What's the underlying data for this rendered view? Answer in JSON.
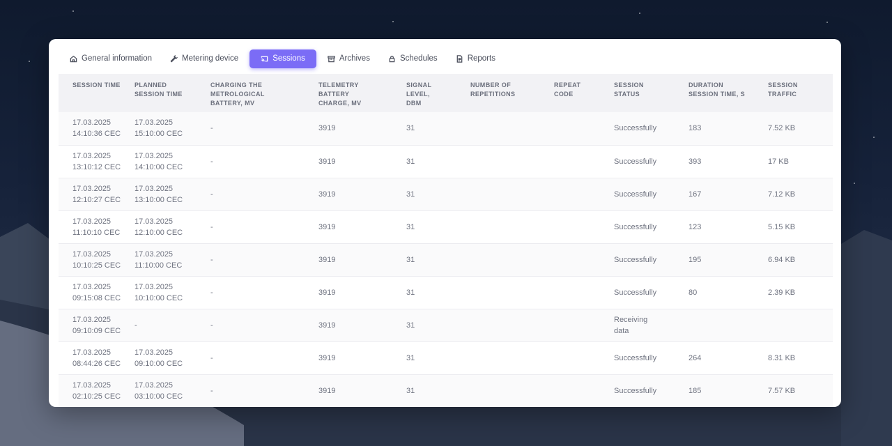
{
  "tabs": [
    {
      "label": "General information",
      "icon": "home-icon",
      "active": false
    },
    {
      "label": "Metering device",
      "icon": "wrench-icon",
      "active": false
    },
    {
      "label": "Sessions",
      "icon": "cast-icon",
      "active": true
    },
    {
      "label": "Archives",
      "icon": "archive-icon",
      "active": false
    },
    {
      "label": "Schedules",
      "icon": "lock-icon",
      "active": false
    },
    {
      "label": "Reports",
      "icon": "document-icon",
      "active": false
    }
  ],
  "accent_color": "#7b6cf6",
  "table": {
    "columns": [
      "SESSION TIME",
      "PLANNED SESSION TIME",
      "CHARGING THE METROLOGICAL BATTERY, MV",
      "TELEMETRY BATTERY CHARGE, MV",
      "SIGNAL LEVEL, DBM",
      "NUMBER OF REPETITIONS",
      "REPEAT CODE",
      "SESSION STATUS",
      "DURATION SESSION TIME, S",
      "SESSION TRAFFIC"
    ],
    "rows": [
      {
        "session_date": "17.03.2025",
        "session_time": "14:10:36 CEC",
        "planned_date": "17.03.2025",
        "planned_time": "15:10:00 CEC",
        "metro_battery": "-",
        "telemetry_battery": "3919",
        "signal": "31",
        "repetitions": "",
        "repeat_code": "",
        "status": "Successfully",
        "duration": "183",
        "traffic": "7.52 KB"
      },
      {
        "session_date": "17.03.2025",
        "session_time": "13:10:12 CEC",
        "planned_date": "17.03.2025",
        "planned_time": "14:10:00 CEC",
        "metro_battery": "-",
        "telemetry_battery": "3919",
        "signal": "31",
        "repetitions": "",
        "repeat_code": "",
        "status": "Successfully",
        "duration": "393",
        "traffic": "17 KB"
      },
      {
        "session_date": "17.03.2025",
        "session_time": "12:10:27 CEC",
        "planned_date": "17.03.2025",
        "planned_time": "13:10:00 CEC",
        "metro_battery": "-",
        "telemetry_battery": "3919",
        "signal": "31",
        "repetitions": "",
        "repeat_code": "",
        "status": "Successfully",
        "duration": "167",
        "traffic": "7.12 KB"
      },
      {
        "session_date": "17.03.2025",
        "session_time": "11:10:10 CEC",
        "planned_date": "17.03.2025",
        "planned_time": "12:10:00 CEC",
        "metro_battery": "-",
        "telemetry_battery": "3919",
        "signal": "31",
        "repetitions": "",
        "repeat_code": "",
        "status": "Successfully",
        "duration": "123",
        "traffic": "5.15 KB"
      },
      {
        "session_date": "17.03.2025",
        "session_time": "10:10:25 CEC",
        "planned_date": "17.03.2025",
        "planned_time": "11:10:00 CEC",
        "metro_battery": "-",
        "telemetry_battery": "3919",
        "signal": "31",
        "repetitions": "",
        "repeat_code": "",
        "status": "Successfully",
        "duration": "195",
        "traffic": "6.94 KB"
      },
      {
        "session_date": "17.03.2025",
        "session_time": "09:15:08 CEC",
        "planned_date": "17.03.2025",
        "planned_time": "10:10:00 CEC",
        "metro_battery": "-",
        "telemetry_battery": "3919",
        "signal": "31",
        "repetitions": "",
        "repeat_code": "",
        "status": "Successfully",
        "duration": "80",
        "traffic": "2.39 KB"
      },
      {
        "session_date": "17.03.2025",
        "session_time": "09:10:09 CEC",
        "planned_date": "-",
        "planned_time": "",
        "metro_battery": "-",
        "telemetry_battery": "3919",
        "signal": "31",
        "repetitions": "",
        "repeat_code": "",
        "status": "Receiving data",
        "duration": "",
        "traffic": ""
      },
      {
        "session_date": "17.03.2025",
        "session_time": "08:44:26 CEC",
        "planned_date": "17.03.2025",
        "planned_time": "09:10:00 CEC",
        "metro_battery": "-",
        "telemetry_battery": "3919",
        "signal": "31",
        "repetitions": "",
        "repeat_code": "",
        "status": "Successfully",
        "duration": "264",
        "traffic": "8.31 KB"
      },
      {
        "session_date": "17.03.2025",
        "session_time": "02:10:25 CEC",
        "planned_date": "17.03.2025",
        "planned_time": "03:10:00 CEC",
        "metro_battery": "-",
        "telemetry_battery": "3919",
        "signal": "31",
        "repetitions": "",
        "repeat_code": "",
        "status": "Successfully",
        "duration": "185",
        "traffic": "7.57 KB"
      }
    ]
  }
}
